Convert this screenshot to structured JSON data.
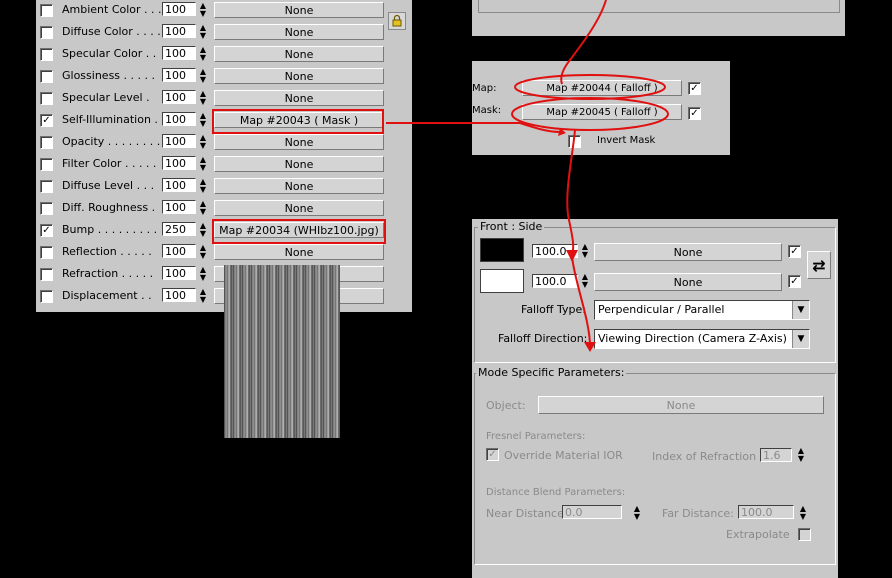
{
  "maps_panel": {
    "rows": [
      {
        "label": "Ambient Color . . .",
        "checked": false,
        "amount": "100",
        "map": "None"
      },
      {
        "label": "Diffuse Color . . . .",
        "checked": false,
        "amount": "100",
        "map": "None"
      },
      {
        "label": "Specular Color . .",
        "checked": false,
        "amount": "100",
        "map": "None"
      },
      {
        "label": "Glossiness . . . . .",
        "checked": false,
        "amount": "100",
        "map": "None"
      },
      {
        "label": "Specular Level .",
        "checked": false,
        "amount": "100",
        "map": "None"
      },
      {
        "label": "Self-Illumination .",
        "checked": true,
        "amount": "100",
        "map": "Map #20043  ( Mask )"
      },
      {
        "label": "Opacity . . . . . . . .",
        "checked": false,
        "amount": "100",
        "map": "None"
      },
      {
        "label": "Filter Color . . . . .",
        "checked": false,
        "amount": "100",
        "map": "None"
      },
      {
        "label": "Diffuse Level . . .",
        "checked": false,
        "amount": "100",
        "map": "None"
      },
      {
        "label": "Diff. Roughness .",
        "checked": false,
        "amount": "100",
        "map": "None"
      },
      {
        "label": "Bump . . . . . . . . .",
        "checked": true,
        "amount": "250",
        "map": "Map #20034 (WHIbz100.jpg)"
      },
      {
        "label": "Reflection . . . . .",
        "checked": false,
        "amount": "100",
        "map": "None"
      },
      {
        "label": "Refraction . . . . .",
        "checked": false,
        "amount": "100",
        "map": "None"
      },
      {
        "label": "Displacement . .",
        "checked": false,
        "amount": "100",
        "map": "None"
      }
    ]
  },
  "mask_panel": {
    "map_label": "Map:",
    "mask_label": "Mask:",
    "map_button": "Map #20044  ( Falloff )",
    "mask_button": "Map #20045  ( Falloff )",
    "invert_mask_label": "Invert Mask",
    "invert_checked": false
  },
  "falloff_panel": {
    "front_side_title": "Front : Side",
    "front_amount": "100.0",
    "side_amount": "100.0",
    "front_map": "None",
    "side_map": "None",
    "front_color": "#000000",
    "side_color": "#ffffff",
    "falloff_type_label": "Falloff Type:",
    "falloff_type_value": "Perpendicular / Parallel",
    "falloff_direction_label": "Falloff Direction:",
    "falloff_direction_value": "Viewing Direction (Camera Z-Axis)",
    "mode_title": "Mode Specific Parameters:",
    "object_label": "Object:",
    "object_value": "None",
    "fresnel_title": "Fresnel Parameters:",
    "override_ior_label": "Override Material IOR",
    "index_of_refraction_label": "Index of Refraction",
    "index_of_refraction_value": "1.6",
    "distance_title": "Distance Blend Parameters:",
    "near_label": "Near Distance:",
    "near_value": "0.0",
    "far_label": "Far Distance:",
    "far_value": "100.0",
    "extrapolate_label": "Extrapolate"
  },
  "colors": {
    "annotation_red": "#e01010",
    "panel_gray": "#c8c8c8",
    "background": "#000000"
  }
}
